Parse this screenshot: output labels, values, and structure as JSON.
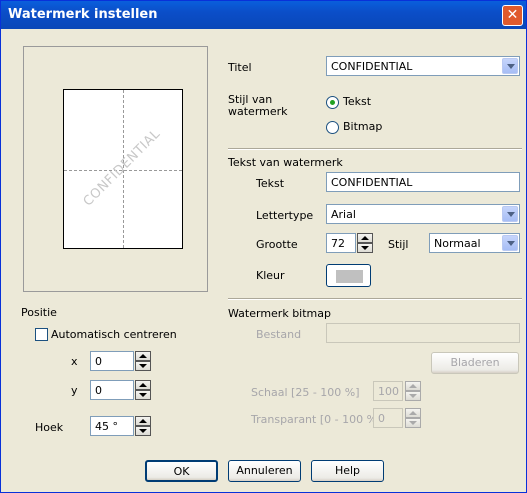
{
  "window": {
    "title": "Watermerk instellen",
    "close_glyph": "✕"
  },
  "preview": {
    "watermark_text": "CONFIDENTIAL"
  },
  "title_field": {
    "label": "Titel",
    "value": "CONFIDENTIAL"
  },
  "style": {
    "label": "Stijl van watermerk",
    "options": [
      {
        "label": "Tekst",
        "selected": true
      },
      {
        "label": "Bitmap",
        "selected": false
      }
    ]
  },
  "text_section": {
    "heading": "Tekst van watermerk",
    "text_label": "Tekst",
    "text_value": "CONFIDENTIAL",
    "font_label": "Lettertype",
    "font_value": "Arial",
    "size_label": "Grootte",
    "size_value": "72",
    "style_label": "Stijl",
    "style_value": "Normaal",
    "color_label": "Kleur",
    "color_value": "#C0C0C0"
  },
  "position": {
    "heading": "Positie",
    "auto_center_label": "Automatisch centreren",
    "auto_center_checked": false,
    "x_label": "x",
    "x_value": "0",
    "y_label": "y",
    "y_value": "0",
    "angle_label": "Hoek",
    "angle_value": "45 °"
  },
  "bitmap_section": {
    "heading": "Watermerk bitmap",
    "file_label": "Bestand",
    "file_value": "",
    "browse_label": "Bladeren",
    "scale_label": "Schaal [25 - 100 %]",
    "scale_value": "100",
    "transparent_label": "Transparant [0 - 100 %]",
    "transparent_value": "0"
  },
  "buttons": {
    "ok": "OK",
    "cancel": "Annuleren",
    "help": "Help"
  }
}
